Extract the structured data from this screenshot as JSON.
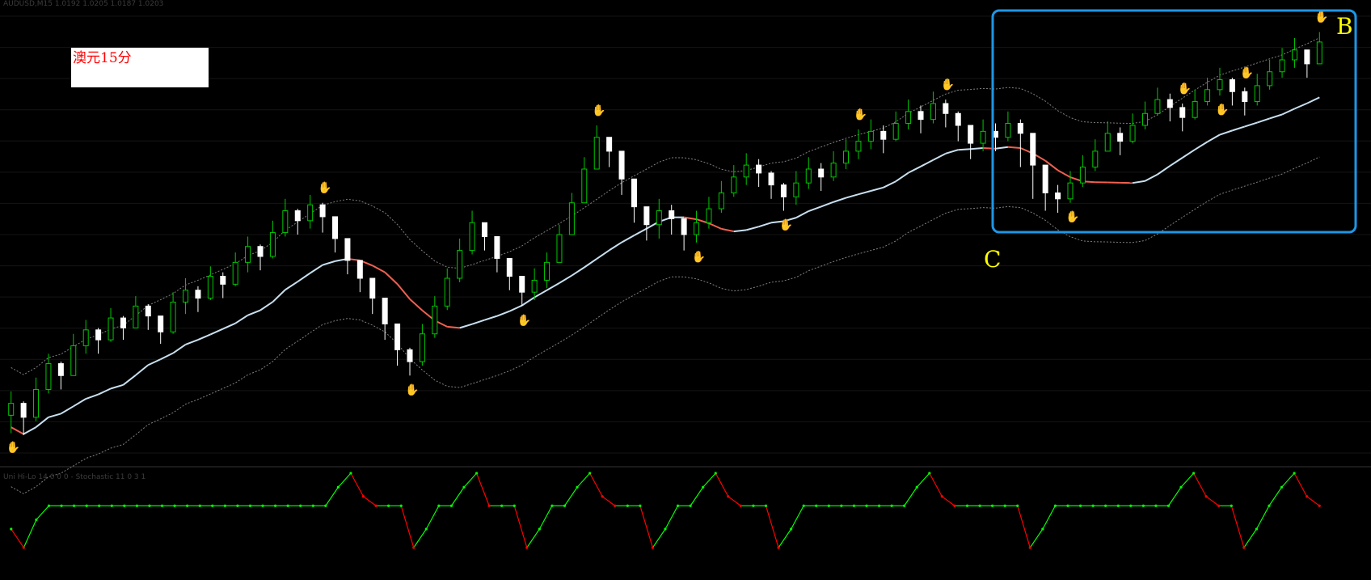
{
  "window": {
    "main_header": "AUDUSD,M15  1.0192 1.0205 1.0187 1.0203",
    "sub_header": "Uni Hi-Lo 14 0 0 0 - Stochastic 11 0 3 1"
  },
  "annotations": {
    "instrument_label": "澳元15分",
    "marker_b": "B",
    "marker_c": "C"
  },
  "colors": {
    "background": "#000000",
    "candle_bull": "#00c800",
    "candle_bear": "#ffffff",
    "ma_up": "#c8e0f0",
    "ma_down": "#f06050",
    "bands": "#808080",
    "fractal_up": "#ff2020",
    "fractal_down": "#3a8cff",
    "osc_up": "#00ff00",
    "osc_down": "#ff0000",
    "highlight_box": "#1e96e6",
    "marker_text": "#ffff00"
  },
  "chart_data": {
    "type": "candlestick",
    "closes": [
      1.0165,
      1.0158,
      1.0172,
      1.0185,
      1.0179,
      1.0194,
      1.0202,
      1.0197,
      1.0208,
      1.0203,
      1.0214,
      1.0209,
      1.0201,
      1.0216,
      1.0222,
      1.0218,
      1.0229,
      1.0225,
      1.0236,
      1.0244,
      1.0239,
      1.0251,
      1.0262,
      1.0257,
      1.0265,
      1.0259,
      1.0248,
      1.0237,
      1.0228,
      1.0218,
      1.0205,
      1.0192,
      1.0186,
      1.02,
      1.0214,
      1.0228,
      1.0242,
      1.0256,
      1.0249,
      1.0238,
      1.0229,
      1.0221,
      1.0227,
      1.0236,
      1.025,
      1.0266,
      1.0283,
      1.0299,
      1.0292,
      1.0278,
      1.0264,
      1.0255,
      1.0262,
      1.0258,
      1.025,
      1.0256,
      1.0263,
      1.0271,
      1.0279,
      1.0285,
      1.0281,
      1.0275,
      1.0269,
      1.0276,
      1.0283,
      1.0279,
      1.0286,
      1.0292,
      1.0297,
      1.0302,
      1.0298,
      1.0306,
      1.0312,
      1.0308,
      1.0316,
      1.0311,
      1.0305,
      1.0296,
      1.0302,
      1.0299,
      1.0306,
      1.0301,
      1.0285,
      1.0271,
      1.0268,
      1.0276,
      1.0284,
      1.0292,
      1.0301,
      1.0297,
      1.0305,
      1.0311,
      1.0318,
      1.0314,
      1.0309,
      1.0317,
      1.0323,
      1.0328,
      1.0322,
      1.0317,
      1.0325,
      1.0332,
      1.0338,
      1.0343,
      1.0336,
      1.0347
    ],
    "highs": [
      1.0171,
      1.0166,
      1.0178,
      1.019,
      1.0186,
      1.02,
      1.0207,
      1.0203,
      1.0213,
      1.0209,
      1.0219,
      1.0215,
      1.0208,
      1.0221,
      1.0228,
      1.0224,
      1.0234,
      1.0231,
      1.0241,
      1.0249,
      1.0245,
      1.0257,
      1.0268,
      1.0263,
      1.027,
      1.0266,
      1.0255,
      1.0244,
      1.0235,
      1.0225,
      1.0212,
      1.02,
      1.0193,
      1.0205,
      1.0219,
      1.0233,
      1.0248,
      1.0262,
      1.0256,
      1.0245,
      1.0236,
      1.0228,
      1.0233,
      1.0241,
      1.0255,
      1.0271,
      1.0289,
      1.0305,
      1.0298,
      1.0285,
      1.0271,
      1.0262,
      1.0268,
      1.0265,
      1.0257,
      1.0262,
      1.0269,
      1.0277,
      1.0285,
      1.0291,
      1.0288,
      1.0282,
      1.0276,
      1.0282,
      1.0289,
      1.0286,
      1.0292,
      1.0298,
      1.0303,
      1.0308,
      1.0305,
      1.0312,
      1.0318,
      1.0315,
      1.0322,
      1.0318,
      1.0312,
      1.0303,
      1.0308,
      1.0306,
      1.0312,
      1.0308,
      1.0292,
      1.0278,
      1.0275,
      1.0282,
      1.029,
      1.0298,
      1.0307,
      1.0304,
      1.0311,
      1.0317,
      1.0324,
      1.0321,
      1.0316,
      1.0323,
      1.0329,
      1.0334,
      1.0329,
      1.0324,
      1.0331,
      1.0338,
      1.0344,
      1.0349,
      1.0343,
      1.0352
    ],
    "lows": [
      1.015,
      1.0149,
      1.0156,
      1.017,
      1.0172,
      1.0181,
      1.019,
      1.019,
      1.0196,
      1.0197,
      1.0203,
      1.0202,
      1.0195,
      1.02,
      1.021,
      1.0211,
      1.0217,
      1.0218,
      1.0224,
      1.0231,
      1.0232,
      1.0238,
      1.0249,
      1.025,
      1.0253,
      1.0251,
      1.0241,
      1.023,
      1.0221,
      1.021,
      1.0197,
      1.0184,
      1.0179,
      1.0184,
      1.0198,
      1.0212,
      1.0226,
      1.024,
      1.0242,
      1.0231,
      1.0222,
      1.0214,
      1.0217,
      1.0223,
      1.0237,
      1.0252,
      1.0268,
      1.0285,
      1.0284,
      1.027,
      1.0256,
      1.0247,
      1.0248,
      1.025,
      1.0242,
      1.0246,
      1.0253,
      1.0261,
      1.0269,
      1.0275,
      1.0274,
      1.0268,
      1.0262,
      1.0265,
      1.0273,
      1.0272,
      1.0277,
      1.0283,
      1.0288,
      1.0293,
      1.0291,
      1.0297,
      1.0303,
      1.0301,
      1.0306,
      1.0304,
      1.0297,
      1.0288,
      1.0292,
      1.0292,
      1.0297,
      1.0284,
      1.0268,
      1.0262,
      1.0261,
      1.0266,
      1.0274,
      1.0282,
      1.0292,
      1.029,
      1.0296,
      1.0303,
      1.031,
      1.0307,
      1.0302,
      1.0308,
      1.0315,
      1.032,
      1.0315,
      1.031,
      1.0315,
      1.0323,
      1.0329,
      1.0334,
      1.0329,
      1.0337
    ],
    "ylim": [
      1.014,
      1.036
    ],
    "fractals_up": [
      25,
      47,
      68,
      75,
      94,
      99,
      105
    ],
    "fractals_down": [
      0,
      32,
      41,
      55,
      62,
      85,
      97
    ],
    "oscillator": {
      "ylim": [
        -1.0,
        1.0
      ],
      "values": [
        -0.2,
        -0.6,
        0.0,
        0.3,
        0.3,
        0.3,
        0.3,
        0.3,
        0.3,
        0.3,
        0.3,
        0.3,
        0.3,
        0.3,
        0.3,
        0.3,
        0.3,
        0.3,
        0.3,
        0.3,
        0.3,
        0.3,
        0.3,
        0.3,
        0.3,
        0.3,
        0.7,
        1.0,
        0.5,
        0.3,
        0.3,
        0.3,
        -0.6,
        -0.2,
        0.3,
        0.3,
        0.7,
        1.0,
        0.3,
        0.3,
        0.3,
        -0.6,
        -0.2,
        0.3,
        0.3,
        0.7,
        1.0,
        0.5,
        0.3,
        0.3,
        0.3,
        -0.6,
        -0.2,
        0.3,
        0.3,
        0.7,
        1.0,
        0.5,
        0.3,
        0.3,
        0.3,
        -0.6,
        -0.2,
        0.3,
        0.3,
        0.3,
        0.3,
        0.3,
        0.3,
        0.3,
        0.3,
        0.3,
        0.7,
        1.0,
        0.5,
        0.3,
        0.3,
        0.3,
        0.3,
        0.3,
        0.3,
        -0.6,
        -0.2,
        0.3,
        0.3,
        0.3,
        0.3,
        0.3,
        0.3,
        0.3,
        0.3,
        0.3,
        0.3,
        0.7,
        1.0,
        0.5,
        0.3,
        0.3,
        -0.6,
        -0.2,
        0.3,
        0.7,
        1.0,
        0.5,
        0.3
      ]
    }
  }
}
